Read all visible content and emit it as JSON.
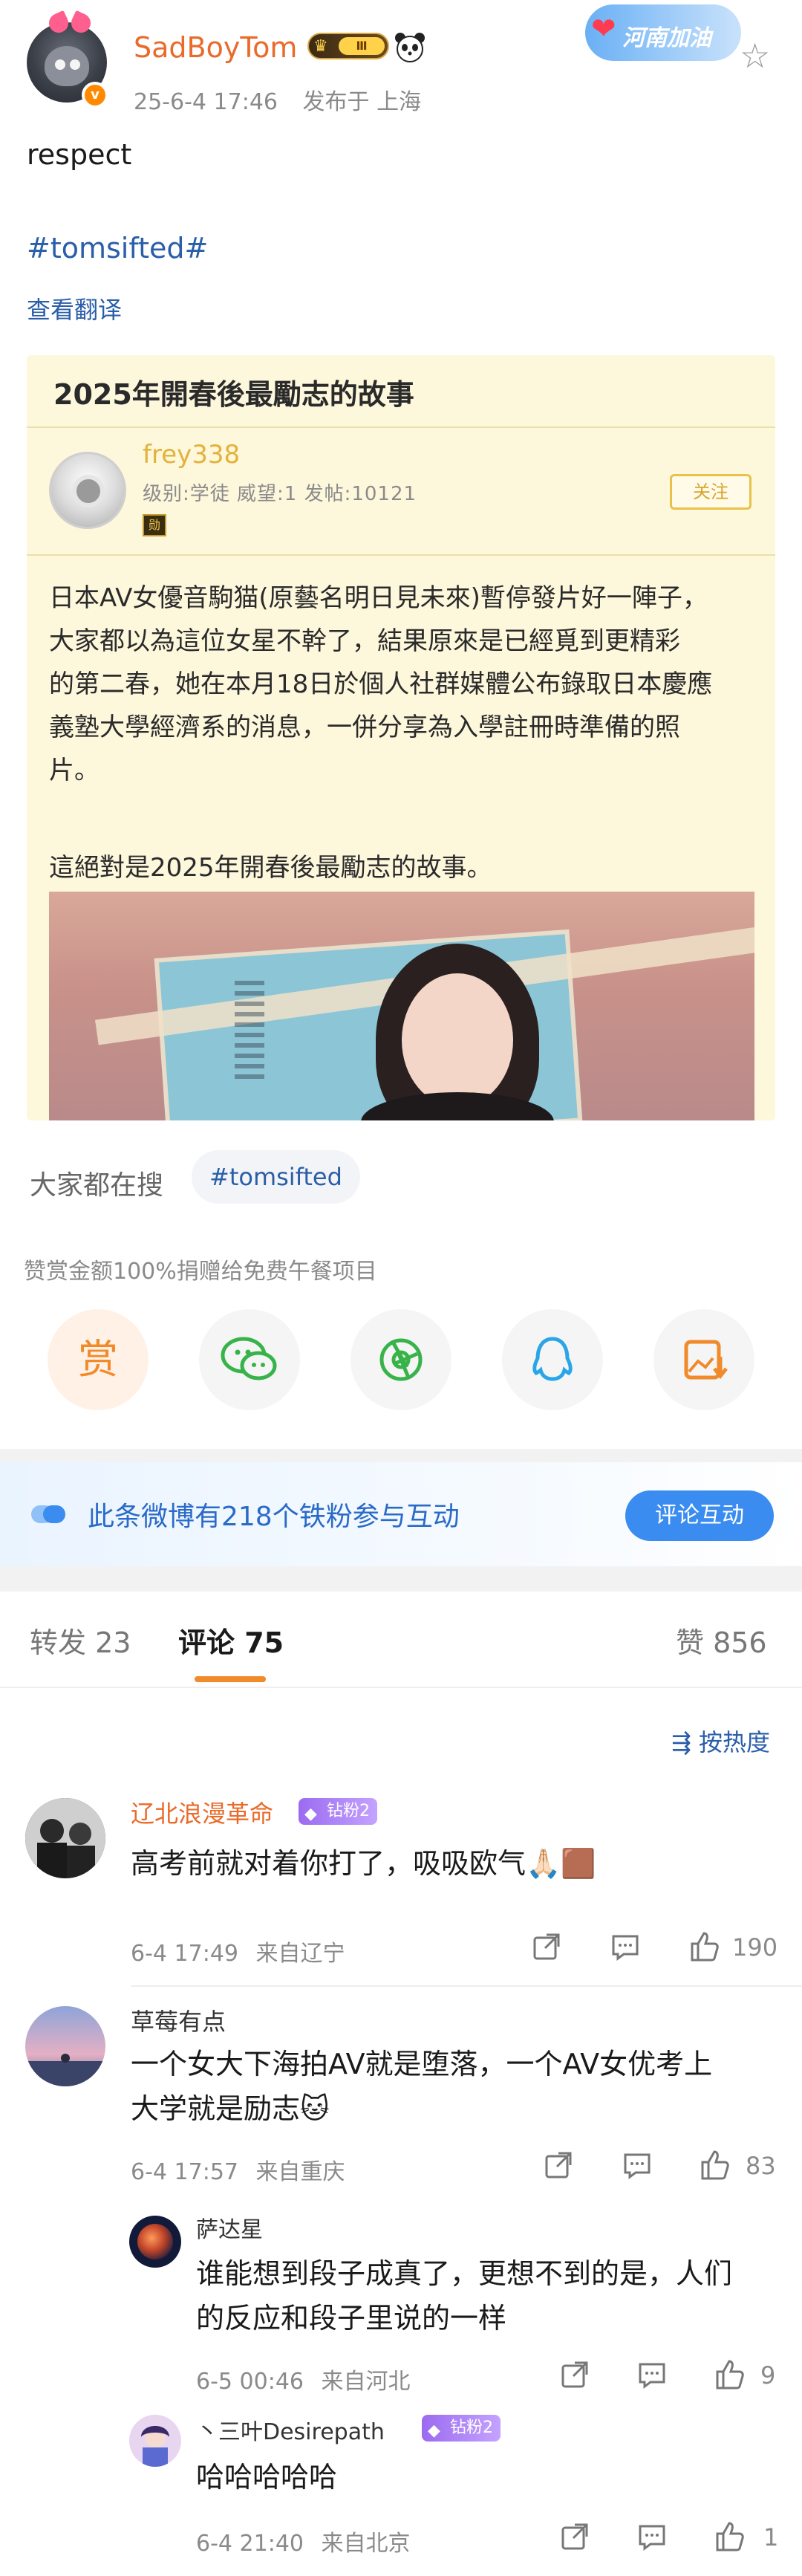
{
  "post": {
    "username": "SadBoyTom",
    "vip_level": "Ⅲ",
    "verified": "v",
    "date": "25-6-4 17:46",
    "location": "发布于 上海",
    "region_badge": "河南加油",
    "text": "respect",
    "hashtag": "#tomsifted#",
    "translate_link": "查看翻译"
  },
  "forum": {
    "title": "2025年開春後最勵志的故事",
    "user": "frey338",
    "stats": "级别:学徒  威望:1  发帖:10121",
    "medal": "勋",
    "follow": "关注",
    "body_lines": [
      "日本AV女優音駒猫(原藝名明日見未來)暫停發片好一陣子，",
      "大家都以為這位女星不幹了，結果原來是已經覓到更精彩",
      "的第二春，她在本月18日於個人社群媒體公布錄取日本慶應",
      "義塾大學經濟系的消息，一併分享為入學註冊時準備的照",
      "片。"
    ],
    "closing": "這絕對是2025年開春後最勵志的故事。"
  },
  "search": {
    "label": "大家都在搜",
    "tag": "#tomsifted"
  },
  "reward": {
    "note": "赞赏金额100%捐赠给免费午餐项目",
    "reward_glyph": "赏"
  },
  "fan_banner": {
    "text": "此条微博有218个铁粉参与互动",
    "button": "评论互动"
  },
  "tabs": {
    "repost": "转发 23",
    "comments": "评论 75",
    "likes": "赞 856"
  },
  "sort": "按热度",
  "comments": [
    {
      "name": "辽北浪漫革命",
      "badge": "钻粉2",
      "text": "高考前就对着你打了，吸吸欧气🙏🏻🟫",
      "time": "6-4 17:49",
      "from": "来自辽宁",
      "likes": "190"
    },
    {
      "name": "草莓有点",
      "text_lines": [
        "一个女大下海拍AV就是堕落，一个AV女优考上",
        "大学就是励志🐱"
      ],
      "time": "6-4 17:57",
      "from": "来自重庆",
      "likes": "83",
      "replies": [
        {
          "name": "萨达星",
          "text_lines": [
            "谁能想到段子成真了，更想不到的是，人们",
            "的反应和段子里说的一样"
          ],
          "time": "6-5 00:46",
          "from": "来自河北",
          "likes": "9"
        },
        {
          "name": "丶三叶Desirepath",
          "badge": "钻粉2",
          "text": "哈哈哈哈哈",
          "time": "6-4 21:40",
          "from": "来自北京",
          "likes": "1"
        }
      ]
    }
  ],
  "colors": {
    "username": "#ea6a2a",
    "link": "#2a5ea8",
    "accent": "#f08a2a",
    "fan_button": "#3a8cf0",
    "badge_purple": "#9b6bf0"
  }
}
